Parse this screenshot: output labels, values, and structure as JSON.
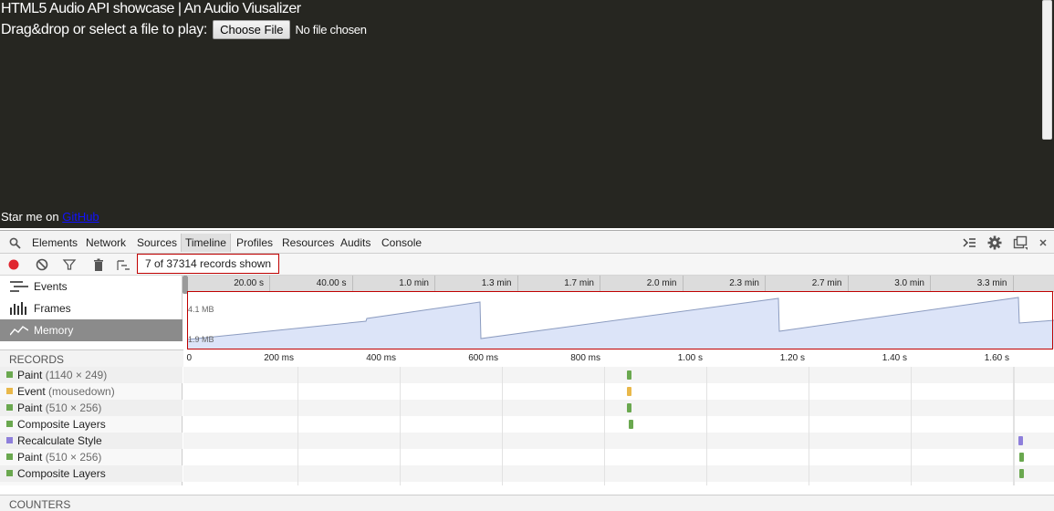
{
  "page": {
    "title": "HTML5 Audio API showcase | An Audio Viusalizer",
    "file_prompt": "Drag&drop or select a file to play:",
    "choose_file_label": "Choose File",
    "no_file_label": "No file chosen",
    "star_text": "Star me on ",
    "github_link": "GitHub"
  },
  "devtools": {
    "tabs": [
      "Elements",
      "Network",
      "Sources",
      "Timeline",
      "Profiles",
      "Resources",
      "Audits",
      "Console"
    ],
    "active_tab": "Timeline",
    "records_shown": "7 of 37314 records shown",
    "overview_items": [
      "Events",
      "Frames",
      "Memory"
    ],
    "selected_overview": "Memory",
    "overview_ticks": [
      "20.00 s",
      "40.00 s",
      "1.0 min",
      "1.3 min",
      "1.7 min",
      "2.0 min",
      "2.3 min",
      "2.7 min",
      "3.0 min",
      "3.3 min"
    ],
    "memory_labels": {
      "top": "4.1 MB",
      "bottom": "1.9 MB"
    },
    "records_title": "RECORDS",
    "record_ticks": [
      "0",
      "200 ms",
      "400 ms",
      "600 ms",
      "800 ms",
      "1.00 s",
      "1.20 s",
      "1.40 s",
      "1.60 s"
    ],
    "records": [
      {
        "name": "Paint",
        "detail": "(1140 × 249)",
        "color": "#6aa84f",
        "time_fraction": 0.524
      },
      {
        "name": "Event",
        "detail": "(mousedown)",
        "color": "#e9b84a",
        "time_fraction": 0.524
      },
      {
        "name": "Paint",
        "detail": "(510 × 256)",
        "color": "#6aa84f",
        "time_fraction": 0.524
      },
      {
        "name": "Composite Layers",
        "detail": "",
        "color": "#6aa84f",
        "time_fraction": 0.526
      },
      {
        "name": "Recalculate Style",
        "detail": "",
        "color": "#8e7fdb",
        "time_fraction": 0.997
      },
      {
        "name": "Paint",
        "detail": "(510 × 256)",
        "color": "#6aa84f",
        "time_fraction": 0.998
      },
      {
        "name": "Composite Layers",
        "detail": "",
        "color": "#6aa84f",
        "time_fraction": 0.998
      }
    ],
    "counters_title": "COUNTERS"
  }
}
